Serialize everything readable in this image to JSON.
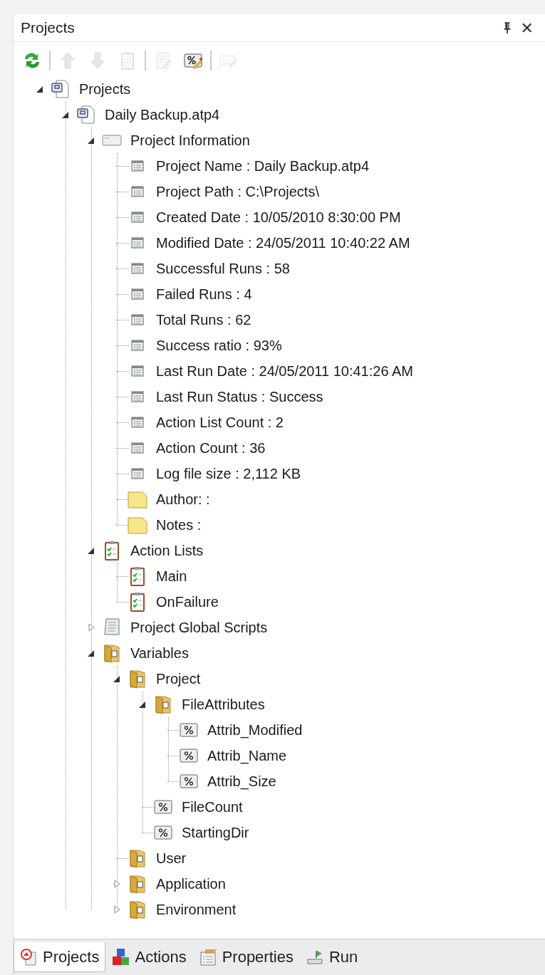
{
  "panel": {
    "title": "Projects",
    "close": "✕"
  },
  "toolbar": [
    {
      "kind": "refresh",
      "disabled": false
    },
    {
      "kind": "separator"
    },
    {
      "kind": "up",
      "disabled": true
    },
    {
      "kind": "down",
      "disabled": true
    },
    {
      "kind": "clipboard",
      "disabled": true
    },
    {
      "kind": "separator"
    },
    {
      "kind": "edit",
      "disabled": true
    },
    {
      "kind": "variable",
      "disabled": false
    },
    {
      "kind": "separator"
    },
    {
      "kind": "comment",
      "disabled": true
    }
  ],
  "tree": [
    {
      "label": "Projects",
      "kind": "project",
      "expanded": true,
      "children": [
        {
          "label": "Daily Backup.atp4",
          "kind": "project",
          "expanded": true,
          "children": [
            {
              "label": "Project Information",
              "kind": "info",
              "expanded": true,
              "children": [
                {
                  "label": "Project Name : Daily Backup.atp4",
                  "kind": "property"
                },
                {
                  "label": "Project Path : C:\\Projects\\",
                  "kind": "property"
                },
                {
                  "label": "Created Date : 10/05/2010 8:30:00 PM",
                  "kind": "property"
                },
                {
                  "label": "Modified Date : 24/05/2011 10:40:22 AM",
                  "kind": "property"
                },
                {
                  "label": "Successful Runs : 58",
                  "kind": "property"
                },
                {
                  "label": "Failed Runs : 4",
                  "kind": "property"
                },
                {
                  "label": "Total Runs : 62",
                  "kind": "property"
                },
                {
                  "label": "Success ratio : 93%",
                  "kind": "property"
                },
                {
                  "label": "Last Run Date : 24/05/2011 10:41:26 AM",
                  "kind": "property"
                },
                {
                  "label": "Last Run Status : Success",
                  "kind": "property"
                },
                {
                  "label": "Action List Count : 2",
                  "kind": "property"
                },
                {
                  "label": "Action Count : 36",
                  "kind": "property"
                },
                {
                  "label": "Log file size : 2,112 KB",
                  "kind": "property"
                },
                {
                  "label": "Author:  :",
                  "kind": "note"
                },
                {
                  "label": "Notes :",
                  "kind": "note"
                }
              ]
            },
            {
              "label": "Action Lists",
              "kind": "clipboard",
              "expanded": true,
              "children": [
                {
                  "label": "Main",
                  "kind": "clipboard"
                },
                {
                  "label": "OnFailure",
                  "kind": "clipboard"
                }
              ]
            },
            {
              "label": "Project Global Scripts",
              "kind": "script",
              "expanded": false
            },
            {
              "label": "Variables",
              "kind": "folder",
              "expanded": true,
              "children": [
                {
                  "label": "Project",
                  "kind": "folder",
                  "expanded": true,
                  "children": [
                    {
                      "label": "FileAttributes",
                      "kind": "folder",
                      "expanded": true,
                      "children": [
                        {
                          "label": "Attrib_Modified",
                          "kind": "variable"
                        },
                        {
                          "label": "Attrib_Name",
                          "kind": "variable"
                        },
                        {
                          "label": "Attrib_Size",
                          "kind": "variable"
                        }
                      ]
                    },
                    {
                      "label": "FileCount",
                      "kind": "variable"
                    },
                    {
                      "label": "StartingDir",
                      "kind": "variable"
                    }
                  ]
                },
                {
                  "label": "User",
                  "kind": "folder"
                },
                {
                  "label": "Application",
                  "kind": "folder",
                  "expanded": false
                },
                {
                  "label": "Environment",
                  "kind": "folder",
                  "expanded": false
                }
              ]
            }
          ]
        }
      ]
    }
  ],
  "tabs": [
    {
      "label": "Projects",
      "kind": "projects",
      "selected": true
    },
    {
      "label": "Actions",
      "kind": "actions",
      "selected": false
    },
    {
      "label": "Properties",
      "kind": "properties",
      "selected": false
    },
    {
      "label": "Run",
      "kind": "run",
      "selected": false
    }
  ]
}
